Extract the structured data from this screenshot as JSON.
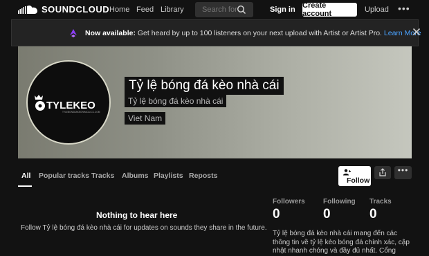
{
  "nav": {
    "logo_text": "SOUNDCLOUD",
    "links": [
      "Home",
      "Feed",
      "Library"
    ],
    "search_placeholder": "Search for a",
    "signin": "Sign in",
    "create_account": "Create account",
    "upload": "Upload",
    "more": "•••"
  },
  "banner": {
    "bold": "Now available:",
    "text": " Get heard by up to 100 listeners on your next upload with Artist or Artist Pro. ",
    "link": "Learn More"
  },
  "profile": {
    "name": "Tỷ lệ bóng đá kèo nhà cái",
    "subtitle": "Tỷ lệ bóng đá kèo nhà cái",
    "location": "Viet Nam",
    "avatar_brand": "TYLEKEO",
    "avatar_tagline": "TYLEBONGDAKEONHACAI.CC.COM",
    "accent_color": "#2ecc71"
  },
  "tabs": [
    "All",
    "Popular tracks",
    "Tracks",
    "Albums",
    "Playlists",
    "Reposts"
  ],
  "actions": {
    "follow": "Follow",
    "more": "•••"
  },
  "empty_state": {
    "title": "Nothing to hear here",
    "subtitle": "Follow Tỷ lệ bóng đá kèo nhà cái for updates on sounds they share in the future."
  },
  "stats": [
    {
      "label": "Followers",
      "value": "0"
    },
    {
      "label": "Following",
      "value": "0"
    },
    {
      "label": "Tracks",
      "value": "0"
    }
  ],
  "bio": "Tỷ lệ bóng đá kèo nhà cái mang đến các thông tin về tỷ lệ kèo bóng đá chính xác, cập nhật nhanh chóng và đầy đủ nhất. Cổng thông tin"
}
